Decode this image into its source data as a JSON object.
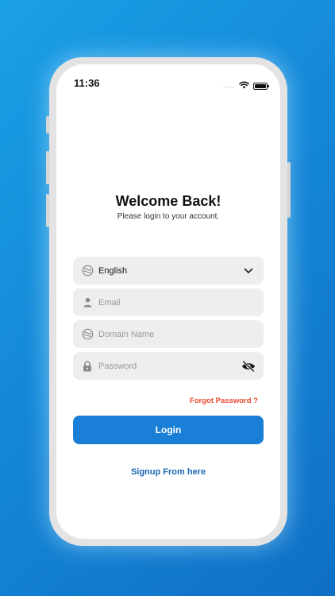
{
  "status_bar": {
    "time": "11:36",
    "signal_dots": "....",
    "icons": [
      "wifi-icon",
      "battery-icon"
    ]
  },
  "header": {
    "title": "Welcome Back!",
    "subtitle": "Please login to your account."
  },
  "form": {
    "language": {
      "value": "English",
      "icon": "globe-icon",
      "trailing_icon": "chevron-down-icon"
    },
    "email": {
      "placeholder": "Email",
      "value": "",
      "icon": "user-icon"
    },
    "domain": {
      "placeholder": "Domain Name",
      "value": "",
      "icon": "globe-icon"
    },
    "password": {
      "placeholder": "Password",
      "value": "",
      "icon": "lock-icon",
      "trailing_icon": "eye-off-icon"
    },
    "forgot_label": "Forgot Password ?",
    "login_label": "Login",
    "signup_label": "Signup From here"
  },
  "colors": {
    "background_start": "#1aa0e6",
    "background_end": "#0f6fc6",
    "primary": "#1a7fd6",
    "link": "#1a66b3",
    "forgot": "#e84a2f",
    "field_bg": "#eeeeee"
  }
}
